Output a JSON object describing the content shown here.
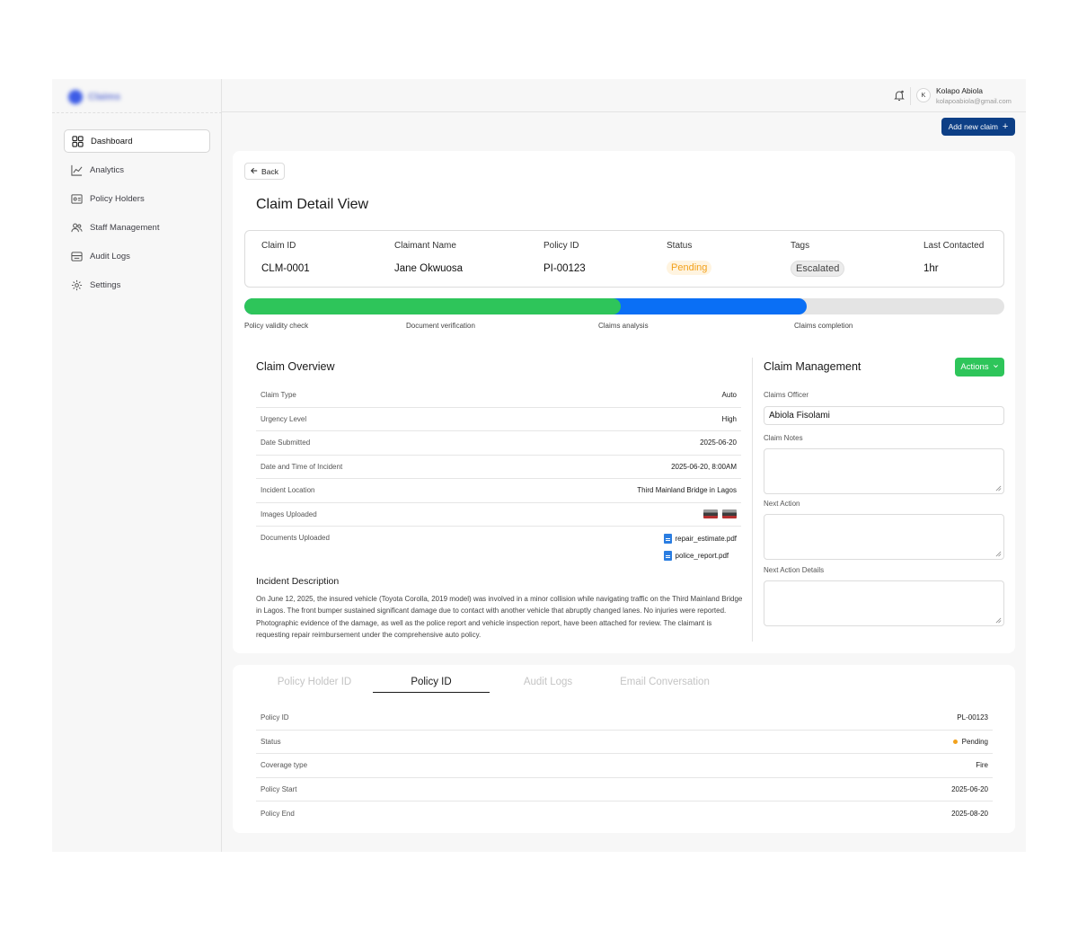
{
  "app": {
    "logo_text": "Claims"
  },
  "sidebar": {
    "items": [
      {
        "label": "Dashboard",
        "icon": "grid-icon",
        "active": true
      },
      {
        "label": "Analytics",
        "icon": "chart-line-icon"
      },
      {
        "label": "Policy Holders",
        "icon": "id-card-icon"
      },
      {
        "label": "Staff Management",
        "icon": "users-icon"
      },
      {
        "label": "Audit Logs",
        "icon": "log-icon"
      },
      {
        "label": "Settings",
        "icon": "gear-icon"
      }
    ]
  },
  "header": {
    "avatar_initial": "K",
    "user_name": "Kolapo Abiola",
    "user_email": "kolapoabiola@gmail.com",
    "add_claim_label": "Add new claim",
    "add_claim_icon": "+"
  },
  "claim": {
    "back_label": "Back",
    "title": "Claim Detail View",
    "summary": {
      "claim_id_label": "Claim ID",
      "claim_id": "CLM-0001",
      "claimant_label": "Claimant Name",
      "claimant": "Jane Okwuosa",
      "policy_id_label": "Policy ID",
      "policy_id": "PI-00123",
      "status_label": "Status",
      "status": "Pending",
      "tags_label": "Tags",
      "tags": "Escalated",
      "last_contacted_label": "Last Contacted",
      "last_contacted": "1hr"
    },
    "progress": {
      "green_fraction": 0.495,
      "blue_fraction": 0.74,
      "steps": [
        "Policy validity check",
        "Document verification",
        "Claims analysis",
        "Claims completion"
      ],
      "colors": {
        "complete": "#2ec55a",
        "in_progress": "#0a6ff5",
        "pending": "#e4e4e4"
      }
    },
    "overview": {
      "title": "Claim Overview",
      "rows": [
        {
          "label": "Claim Type",
          "value": "Auto"
        },
        {
          "label": "Urgency Level",
          "value": "High"
        },
        {
          "label": "Date Submitted",
          "value": "2025-06-20"
        },
        {
          "label": "Date and Time of Incident",
          "value": "2025-06-20, 8:00AM"
        },
        {
          "label": "Incident Location",
          "value": "Third Mainland Bridge in Lagos"
        },
        {
          "label": "Images Uploaded",
          "value": ""
        },
        {
          "label": "Documents Uploaded",
          "value": ""
        }
      ],
      "documents": [
        "repair_estimate.pdf",
        "police_report.pdf"
      ]
    },
    "incident": {
      "title": "Incident Description",
      "text": "On June 12, 2025, the insured vehicle (Toyota Corolla, 2019 model) was involved in a minor collision while navigating traffic on the Third Mainland Bridge in Lagos. The front bumper sustained significant damage due to contact with another vehicle that abruptly changed lanes. No injuries were reported. Photographic evidence of the damage, as well as the police report and vehicle inspection report, have been attached for review. The claimant is requesting repair reimbursement under the comprehensive auto policy."
    },
    "management": {
      "title": "Claim Management",
      "actions_label": "Actions",
      "officer_label": "Claims Officer",
      "officer_value": "Abiola Fisolami",
      "notes_label": "Claim Notes",
      "next_action_label": "Next Action",
      "next_action_details_label": "Next Action Details"
    }
  },
  "tabs": {
    "items": [
      "Policy Holder ID",
      "Policy ID",
      "Audit Logs",
      "Email Conversation"
    ],
    "active": 1
  },
  "policy": {
    "rows": [
      {
        "label": "Policy ID",
        "value": "PL-00123"
      },
      {
        "label": "Status",
        "value": "Pending"
      },
      {
        "label": "Coverage type",
        "value": "Fire"
      },
      {
        "label": "Policy Start",
        "value": "2025-06-20"
      },
      {
        "label": "Policy End",
        "value": "2025-08-20"
      }
    ]
  }
}
